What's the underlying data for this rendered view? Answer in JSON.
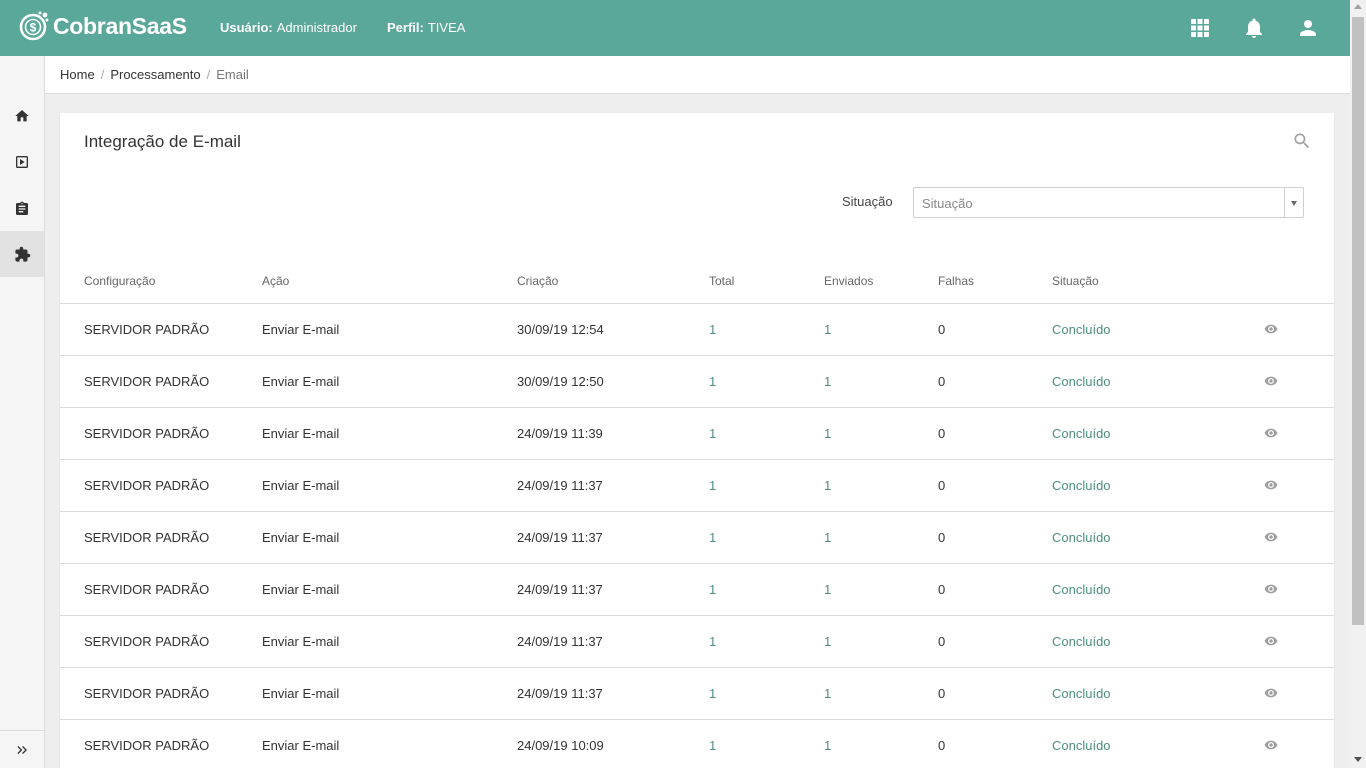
{
  "header": {
    "app_name": "CobranSaaS",
    "user_label": "Usuário:",
    "user_value": "Administrador",
    "profile_label": "Perfil:",
    "profile_value": "TIVEA",
    "icons": [
      "apps-grid-icon",
      "bell-icon",
      "user-icon"
    ],
    "bg_color": "#5aa899"
  },
  "sidebar": {
    "items": [
      "home-icon",
      "video-play-icon",
      "clipboard-icon",
      "extension-puzzle-icon"
    ],
    "active_index": 3,
    "expand_icon": "double-chevron-right-icon"
  },
  "breadcrumb": [
    "Home",
    "Processamento",
    "Email"
  ],
  "card": {
    "title": "Integração de E-mail",
    "filter_label": "Situação",
    "filter_placeholder": "Situação"
  },
  "table": {
    "columns": [
      "Configuração",
      "Ação",
      "Criação",
      "Total",
      "Enviados",
      "Falhas",
      "Situação"
    ],
    "rows": [
      {
        "config": "SERVIDOR PADRÃO",
        "acao": "Enviar E-mail",
        "criacao": "30/09/19 12:54",
        "total": "1",
        "enviados": "1",
        "falhas": "0",
        "situacao": "Concluído"
      },
      {
        "config": "SERVIDOR PADRÃO",
        "acao": "Enviar E-mail",
        "criacao": "30/09/19 12:50",
        "total": "1",
        "enviados": "1",
        "falhas": "0",
        "situacao": "Concluído"
      },
      {
        "config": "SERVIDOR PADRÃO",
        "acao": "Enviar E-mail",
        "criacao": "24/09/19 11:39",
        "total": "1",
        "enviados": "1",
        "falhas": "0",
        "situacao": "Concluído"
      },
      {
        "config": "SERVIDOR PADRÃO",
        "acao": "Enviar E-mail",
        "criacao": "24/09/19 11:37",
        "total": "1",
        "enviados": "1",
        "falhas": "0",
        "situacao": "Concluído"
      },
      {
        "config": "SERVIDOR PADRÃO",
        "acao": "Enviar E-mail",
        "criacao": "24/09/19 11:37",
        "total": "1",
        "enviados": "1",
        "falhas": "0",
        "situacao": "Concluído"
      },
      {
        "config": "SERVIDOR PADRÃO",
        "acao": "Enviar E-mail",
        "criacao": "24/09/19 11:37",
        "total": "1",
        "enviados": "1",
        "falhas": "0",
        "situacao": "Concluído"
      },
      {
        "config": "SERVIDOR PADRÃO",
        "acao": "Enviar E-mail",
        "criacao": "24/09/19 11:37",
        "total": "1",
        "enviados": "1",
        "falhas": "0",
        "situacao": "Concluído"
      },
      {
        "config": "SERVIDOR PADRÃO",
        "acao": "Enviar E-mail",
        "criacao": "24/09/19 11:37",
        "total": "1",
        "enviados": "1",
        "falhas": "0",
        "situacao": "Concluído"
      },
      {
        "config": "SERVIDOR PADRÃO",
        "acao": "Enviar E-mail",
        "criacao": "24/09/19 10:09",
        "total": "1",
        "enviados": "1",
        "falhas": "0",
        "situacao": "Concluído"
      }
    ],
    "row_action_icon": "eye-icon"
  }
}
